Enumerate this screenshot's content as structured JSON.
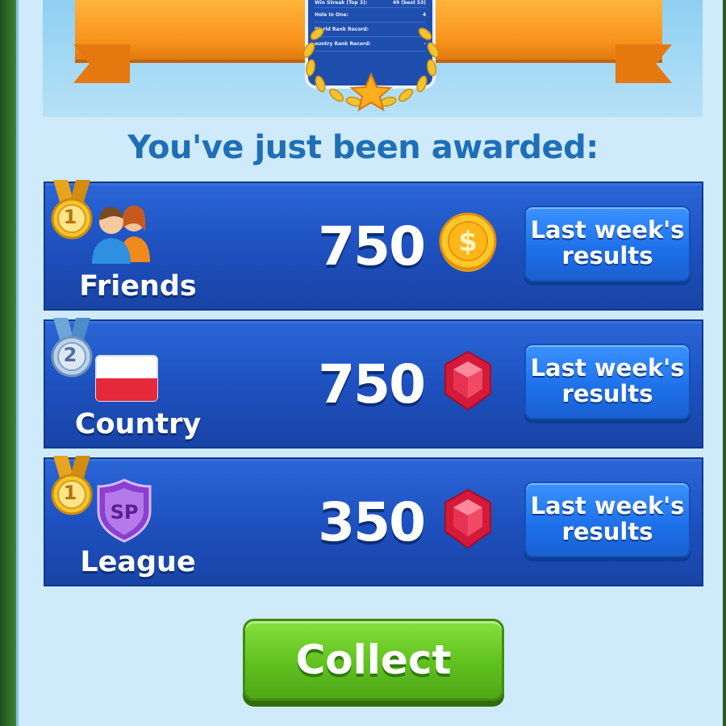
{
  "banner": {
    "stats": [
      {
        "label": "Win Streak (Top 3):",
        "value": "49 (best 53)"
      },
      {
        "label": "Hole In One:",
        "value": "4"
      },
      {
        "label": "World Rank Record:",
        "value": "-"
      },
      {
        "label": "ountry Rank Record:",
        "value": "-"
      }
    ]
  },
  "heading": "You've just been awarded:",
  "awards": [
    {
      "rank": "1",
      "medal": "gold-medal-icon",
      "category": "Friends",
      "category_icon": "friends-icon",
      "amount": "750",
      "reward": "coin-icon",
      "button": [
        "Last week's",
        "results"
      ]
    },
    {
      "rank": "2",
      "medal": "silver-medal-icon",
      "category": "Country",
      "category_icon": "poland-flag-icon",
      "amount": "750",
      "reward": "gem-icon",
      "button": [
        "Last week's",
        "results"
      ]
    },
    {
      "rank": "1",
      "medal": "gold-medal-icon",
      "category": "League",
      "category_icon": "league-shield-icon",
      "league_badge": "SP",
      "amount": "350",
      "reward": "gem-icon",
      "button": [
        "Last week's",
        "results"
      ]
    }
  ],
  "collect_label": "Collect",
  "colors": {
    "heading": "#1f6fb7",
    "row": "#1d4fbd",
    "button_blue": "#1d6fe8",
    "collect_green": "#5fc11f",
    "ribbon_orange": "#f7921c"
  }
}
